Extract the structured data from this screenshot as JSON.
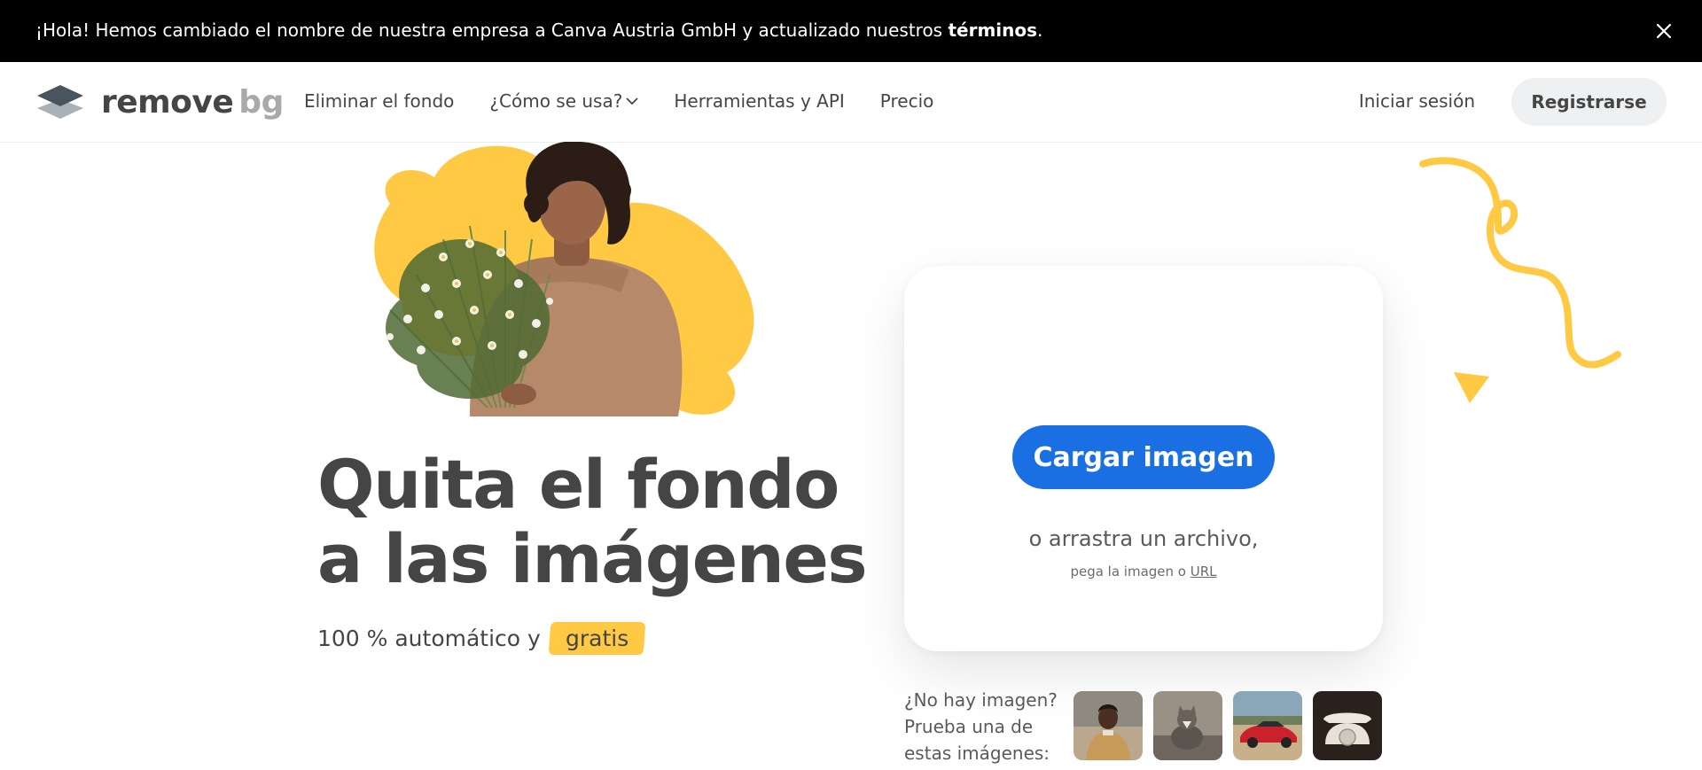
{
  "announcement": {
    "text_prefix": "¡Hola! Hemos cambiado el nombre de nuestra empresa a Canva Austria GmbH y actualizado nuestros ",
    "link_text": "términos",
    "text_suffix": "."
  },
  "header": {
    "logo_word_1": "remove",
    "logo_word_2": "bg",
    "nav": [
      {
        "label": "Eliminar el fondo"
      },
      {
        "label": "¿Cómo se usa?",
        "has_dropdown": true
      },
      {
        "label": "Herramientas y API"
      },
      {
        "label": "Precio"
      }
    ],
    "login_label": "Iniciar sesión",
    "signup_label": "Registrarse"
  },
  "hero": {
    "headline": "Quita el fondo a las imágenes",
    "subline": "100 % automático y",
    "highlight": "gratis"
  },
  "upload": {
    "button_label": "Cargar imagen",
    "drag_text": "o arrastra un archivo,",
    "paste_text": "pega la imagen o ",
    "url_label": "URL"
  },
  "samples": {
    "label": "¿No hay imagen? Prueba una de estas imágenes:",
    "items": [
      {
        "icon": "person-photo-icon"
      },
      {
        "icon": "cat-photo-icon"
      },
      {
        "icon": "car-photo-icon"
      },
      {
        "icon": "telephone-photo-icon"
      }
    ]
  },
  "colors": {
    "accent_blue": "#1a6fe2",
    "accent_yellow": "#ffc943",
    "text_dark": "#454545",
    "announcement_bg": "#000000"
  }
}
